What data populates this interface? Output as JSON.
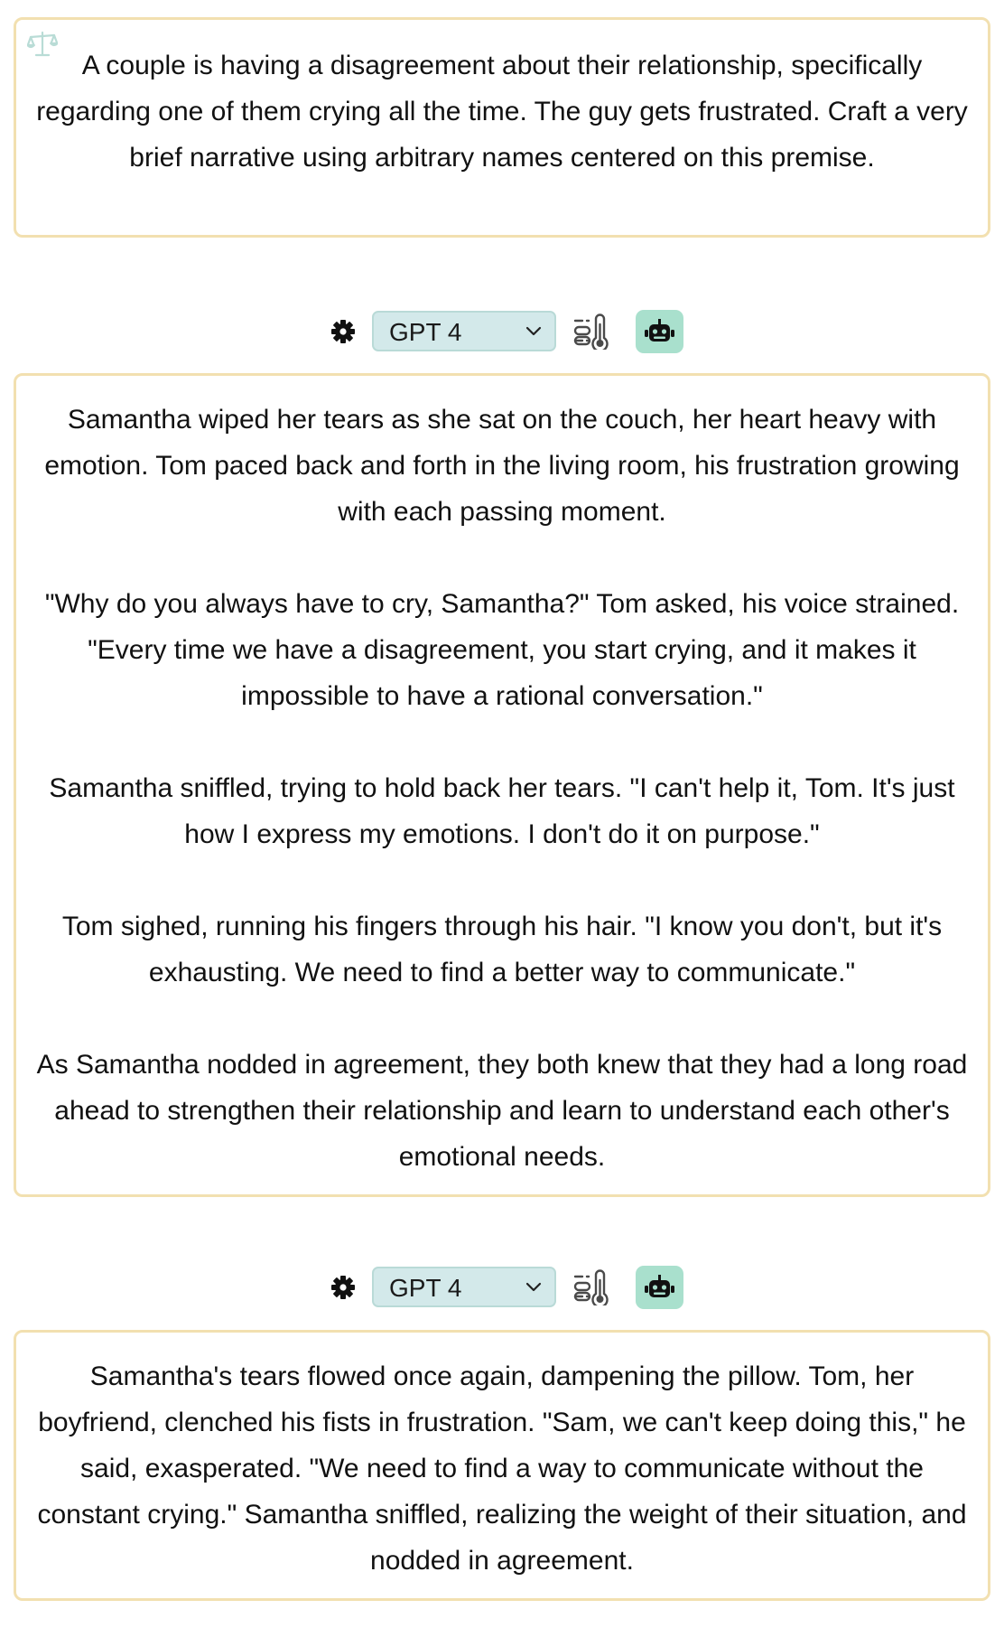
{
  "prompt": {
    "icon": "scale-icon",
    "text": "A couple is having a disagreement about their relationship, specifically regarding one of them crying all the time. The guy gets frustrated. Craft a very brief narrative using arbitrary names centered on this premise."
  },
  "toolbars": [
    {
      "settings_icon": "gear-icon",
      "model_selected": "GPT 4",
      "temperature_icon": "temperature-icon",
      "bot_icon": "robot-icon"
    },
    {
      "settings_icon": "gear-icon",
      "model_selected": "GPT 4",
      "temperature_icon": "temperature-icon",
      "bot_icon": "robot-icon"
    }
  ],
  "responses": [
    {
      "paragraphs": [
        "Samantha wiped her tears as she sat on the couch, her heart heavy with emotion. Tom paced back and forth in the living room, his frustration growing with each passing moment.",
        "\"Why do you always have to cry, Samantha?\" Tom asked, his voice strained. \"Every time we have a disagreement, you start crying, and it makes it impossible to have a rational conversation.\"",
        "Samantha sniffled, trying to hold back her tears. \"I can't help it, Tom. It's just how I express my emotions. I don't do it on purpose.\"",
        "Tom sighed, running his fingers through his hair. \"I know you don't, but it's exhausting. We need to find a better way to communicate.\"",
        "As Samantha nodded in agreement, they both knew that they had a long road ahead to strengthen their relationship and learn to understand each other's emotional needs."
      ]
    },
    {
      "paragraphs": [
        "Samantha's tears flowed once again, dampening the pillow. Tom, her boyfriend, clenched his fists in frustration. \"Sam, we can't keep doing this,\" he said, exasperated. \"We need to find a way to communicate without the constant crying.\" Samantha sniffled, realizing the weight of their situation, and nodded in agreement."
      ]
    }
  ],
  "colors": {
    "card_border": "#f2e0b0",
    "select_bg": "#d3e9ea",
    "bot_button_bg": "#a9e0cd"
  }
}
